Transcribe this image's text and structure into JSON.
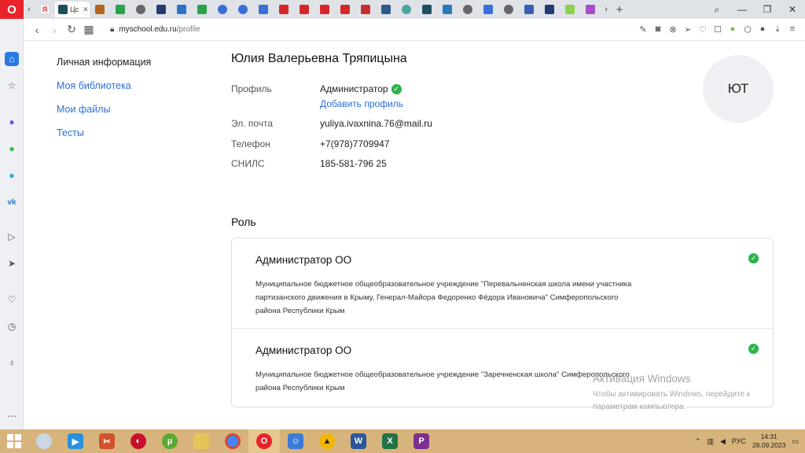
{
  "browser": {
    "active_tab_title": "Цс",
    "url_host": "myschool.edu.ru",
    "url_path": "/profile"
  },
  "nav": {
    "personal_info": "Личная информация",
    "library": "Моя библиотека",
    "files": "Мои файлы",
    "tests": "Тесты"
  },
  "profile": {
    "full_name": "Юлия Валерьевна Тряпицына",
    "initials": "ЮТ",
    "profile_label": "Профиль",
    "profile_value": "Администратор",
    "add_profile_link": "Добавить профиль",
    "email_label": "Эл. почта",
    "email_value": "yuliya.ivaxnina.76@mail.ru",
    "phone_label": "Телефон",
    "phone_value": "+7(978)7709947",
    "snils_label": "СНИЛС",
    "snils_value": "185-581-796 25"
  },
  "roles": {
    "title": "Роль",
    "items": [
      {
        "name": "Администратор ОО",
        "org": "Муниципальное бюджетное общеобразовательное учреждение \"Перевальненская школа имени участника партизанского движения в Крыму, Генерал-Майора Федоренко Фёдора Ивановича\" Симферопольского района Республики Крым"
      },
      {
        "name": "Администратор ОО",
        "org": "Муниципальное бюджетное общеобразовательное учреждение \"Заречненская школа\" Симферопольского района Республики Крым"
      }
    ]
  },
  "watermark": {
    "title": "Активация Windows",
    "text": "Чтобы активировать Windows, перейдите к параметрам компьютера."
  },
  "taskbar": {
    "lang": "РУС",
    "time": "14:31",
    "date": "28.09.2023"
  },
  "colors": {
    "link": "#2b6fd6",
    "check": "#2bb34a",
    "opera_red": "#e8232a",
    "taskbar": "#d7b47c"
  }
}
